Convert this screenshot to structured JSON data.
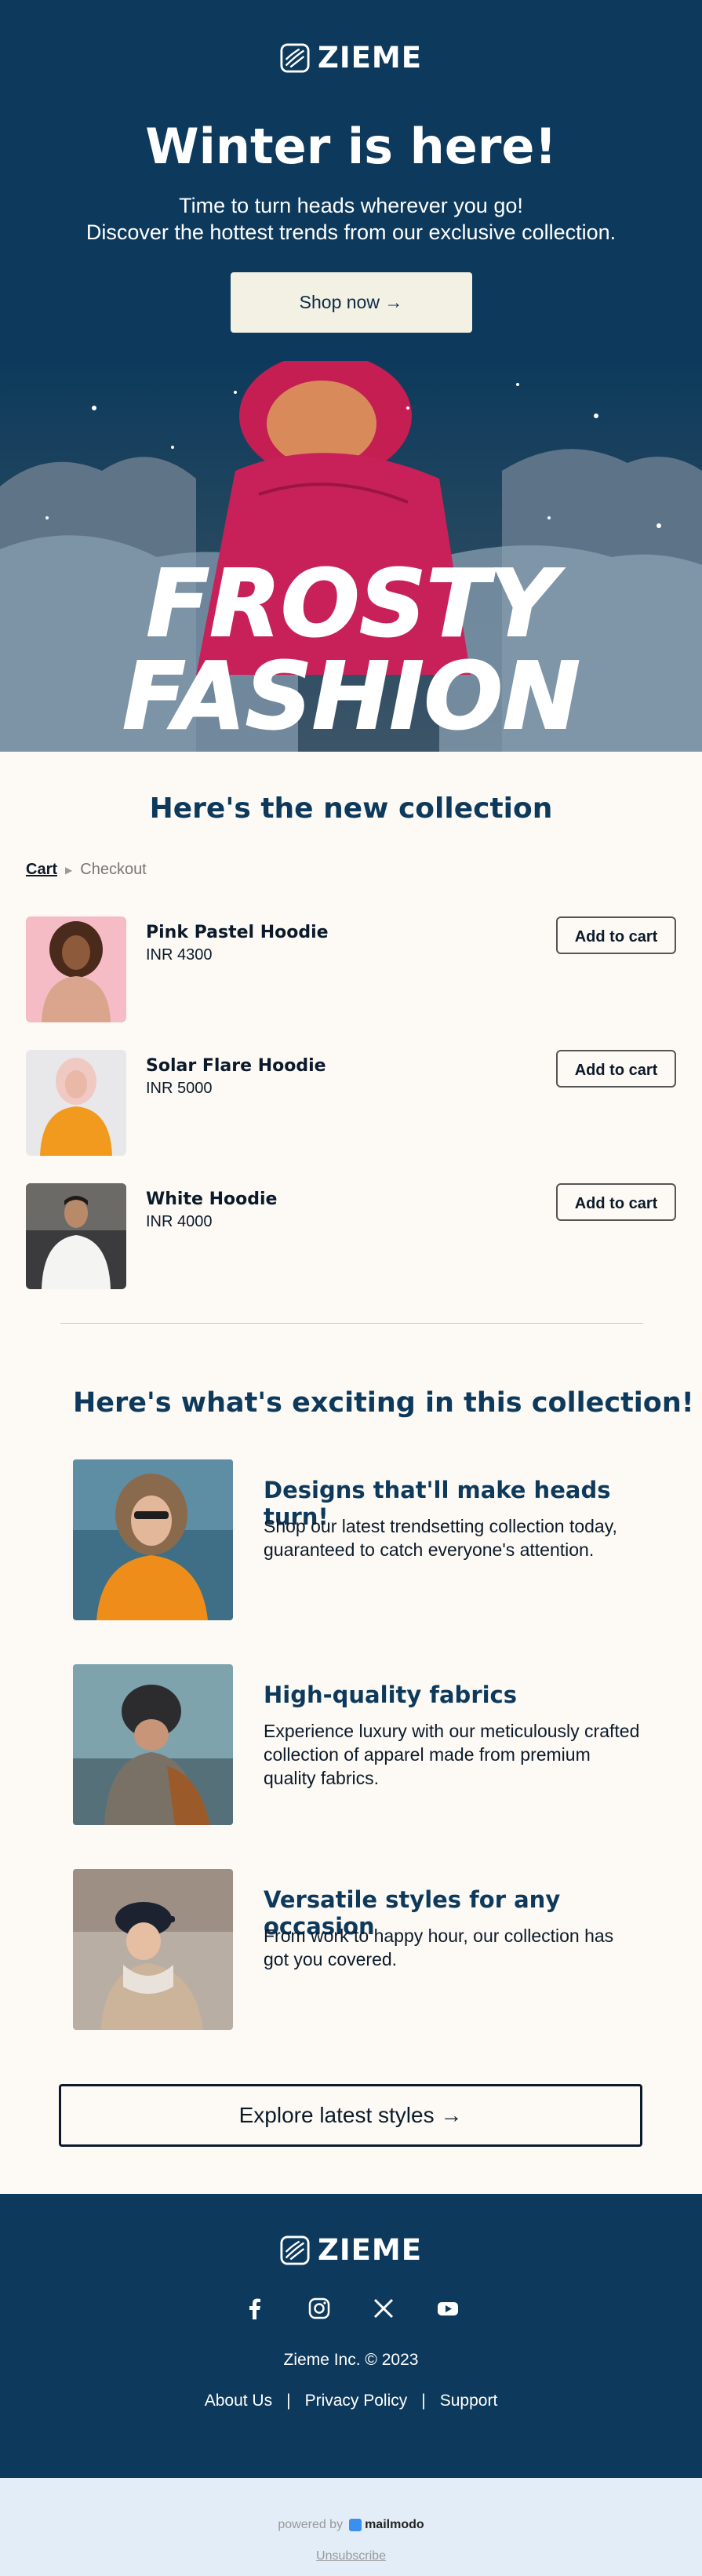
{
  "brand": {
    "name": "ZIEME"
  },
  "hero": {
    "title": "Winter is here!",
    "subtitle_line1": "Time to turn heads wherever you go!",
    "subtitle_line2": "Discover the hottest trends from our exclusive collection.",
    "cta": "Shop now →",
    "banner_line1": "FROSTY",
    "banner_line2": "FASHION"
  },
  "collection": {
    "title": "Here's the new collection",
    "breadcrumb": {
      "cart": "Cart",
      "checkout": "Checkout"
    },
    "products": [
      {
        "name": "Pink Pastel Hoodie",
        "price": "INR 4300",
        "button": "Add to cart"
      },
      {
        "name": "Solar Flare Hoodie",
        "price": "INR 5000",
        "button": "Add to cart"
      },
      {
        "name": "White Hoodie",
        "price": "INR 4000",
        "button": "Add to cart"
      }
    ]
  },
  "exciting": {
    "title": "Here's what's exciting in this collection!",
    "features": [
      {
        "title": "Designs that'll make heads turn!",
        "desc": "Shop our latest trendsetting collection today, guaranteed to catch everyone's attention."
      },
      {
        "title": "High-quality fabrics",
        "desc": "Experience luxury with our meticulously crafted collection of apparel made from premium quality fabrics."
      },
      {
        "title": "Versatile styles for any occasion",
        "desc": "From work to happy hour, our collection has got you covered."
      }
    ],
    "cta": "Explore latest styles →"
  },
  "footer": {
    "socials": [
      "facebook-icon",
      "instagram-icon",
      "x-icon",
      "youtube-icon"
    ],
    "copyright": "Zieme Inc. © 2023",
    "links": [
      "About Us",
      "Privacy Policy",
      "Support"
    ],
    "separator": "|"
  },
  "bottom": {
    "powered_by": "powered by",
    "mailmodo": "mailmodo",
    "unsubscribe": "Unsubscribe"
  },
  "colors": {
    "navy": "#0d3a5c",
    "cream": "#fdfaf5",
    "button_light": "#f3f0e4",
    "bottom_bar": "#e2edf7"
  }
}
